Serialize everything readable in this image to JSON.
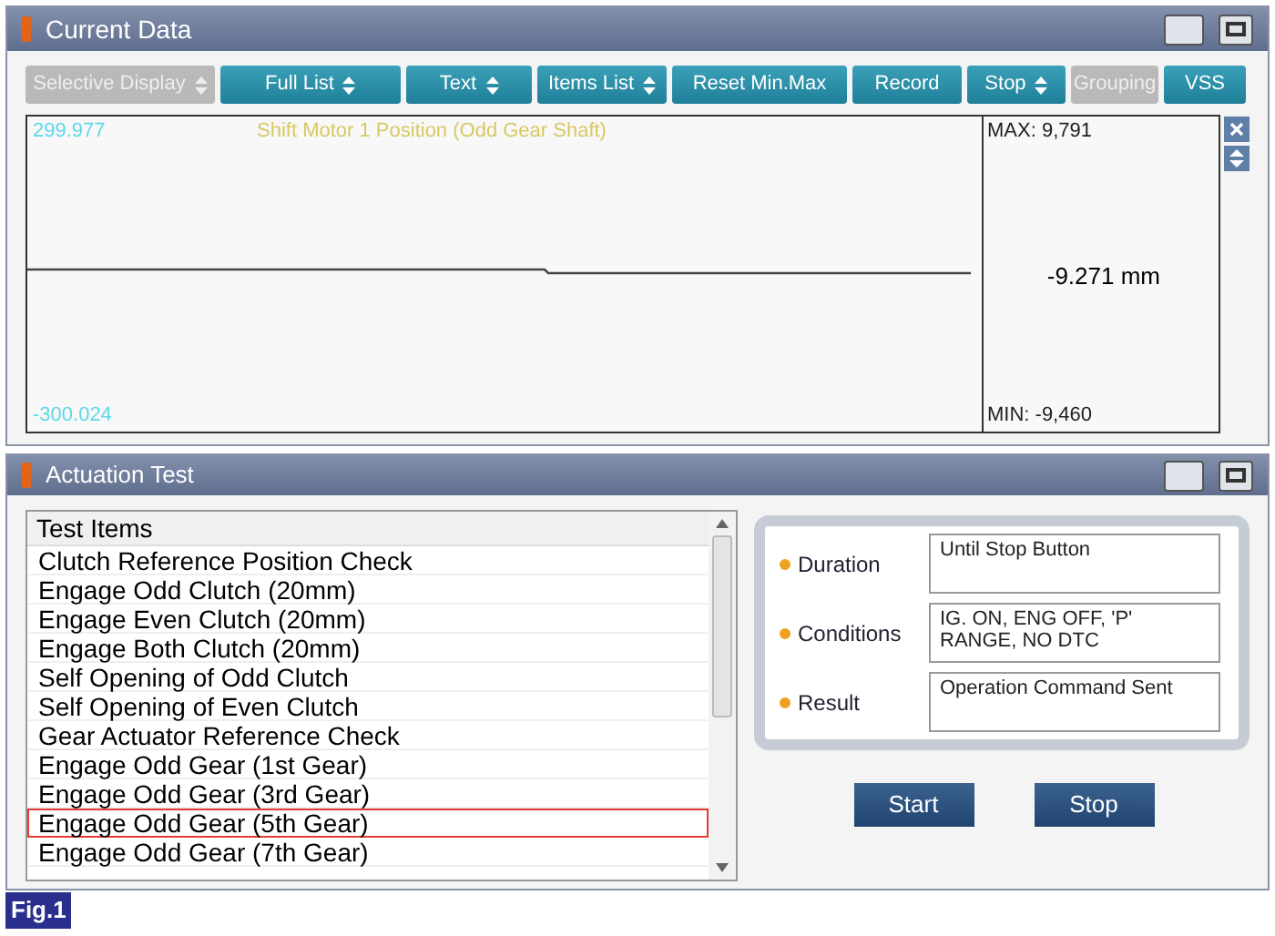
{
  "current_data": {
    "title": "Current Data",
    "toolbar": [
      {
        "label": "Selective Display",
        "dropdown": true,
        "disabled": true
      },
      {
        "label": "Full List",
        "dropdown": true,
        "disabled": false
      },
      {
        "label": "Text",
        "dropdown": true,
        "disabled": false
      },
      {
        "label": "Items List",
        "dropdown": true,
        "disabled": false
      },
      {
        "label": "Reset Min.Max",
        "dropdown": false,
        "disabled": false
      },
      {
        "label": "Record",
        "dropdown": false,
        "disabled": false
      },
      {
        "label": "Stop",
        "dropdown": true,
        "disabled": false
      },
      {
        "label": "Grouping",
        "dropdown": false,
        "disabled": true
      },
      {
        "label": "VSS",
        "dropdown": false,
        "disabled": false
      }
    ],
    "graph": {
      "top_value": "299.977",
      "bottom_value": "-300.024",
      "signal_name": "Shift Motor 1 Position (Odd Gear Shaft)",
      "max": "MAX: 9,791",
      "min": "MIN: -9,460",
      "current": "-9.271 mm"
    }
  },
  "actuation_test": {
    "title": "Actuation Test",
    "list_header": "Test Items",
    "items": [
      {
        "label": "Clutch Reference Position Check",
        "selected": false
      },
      {
        "label": "Engage Odd Clutch (20mm)",
        "selected": false
      },
      {
        "label": "Engage Even Clutch (20mm)",
        "selected": false
      },
      {
        "label": "Engage Both Clutch (20mm)",
        "selected": false
      },
      {
        "label": "Self Opening of Odd Clutch",
        "selected": false
      },
      {
        "label": "Self Opening of Even Clutch",
        "selected": false
      },
      {
        "label": "Gear Actuator Reference Check",
        "selected": false
      },
      {
        "label": "Engage Odd Gear (1st Gear)",
        "selected": false
      },
      {
        "label": "Engage Odd Gear (3rd Gear)",
        "selected": false
      },
      {
        "label": "Engage Odd Gear (5th Gear)",
        "selected": true
      },
      {
        "label": "Engage Odd Gear (7th Gear)",
        "selected": false
      }
    ],
    "details": [
      {
        "label": "Duration",
        "value": "Until Stop Button"
      },
      {
        "label": "Conditions",
        "value": "IG. ON, ENG OFF, 'P' RANGE, NO DTC"
      },
      {
        "label": "Result",
        "value": "Operation Command Sent"
      }
    ],
    "buttons": [
      "Start",
      "Stop"
    ]
  },
  "figure_label": "Fig.1"
}
